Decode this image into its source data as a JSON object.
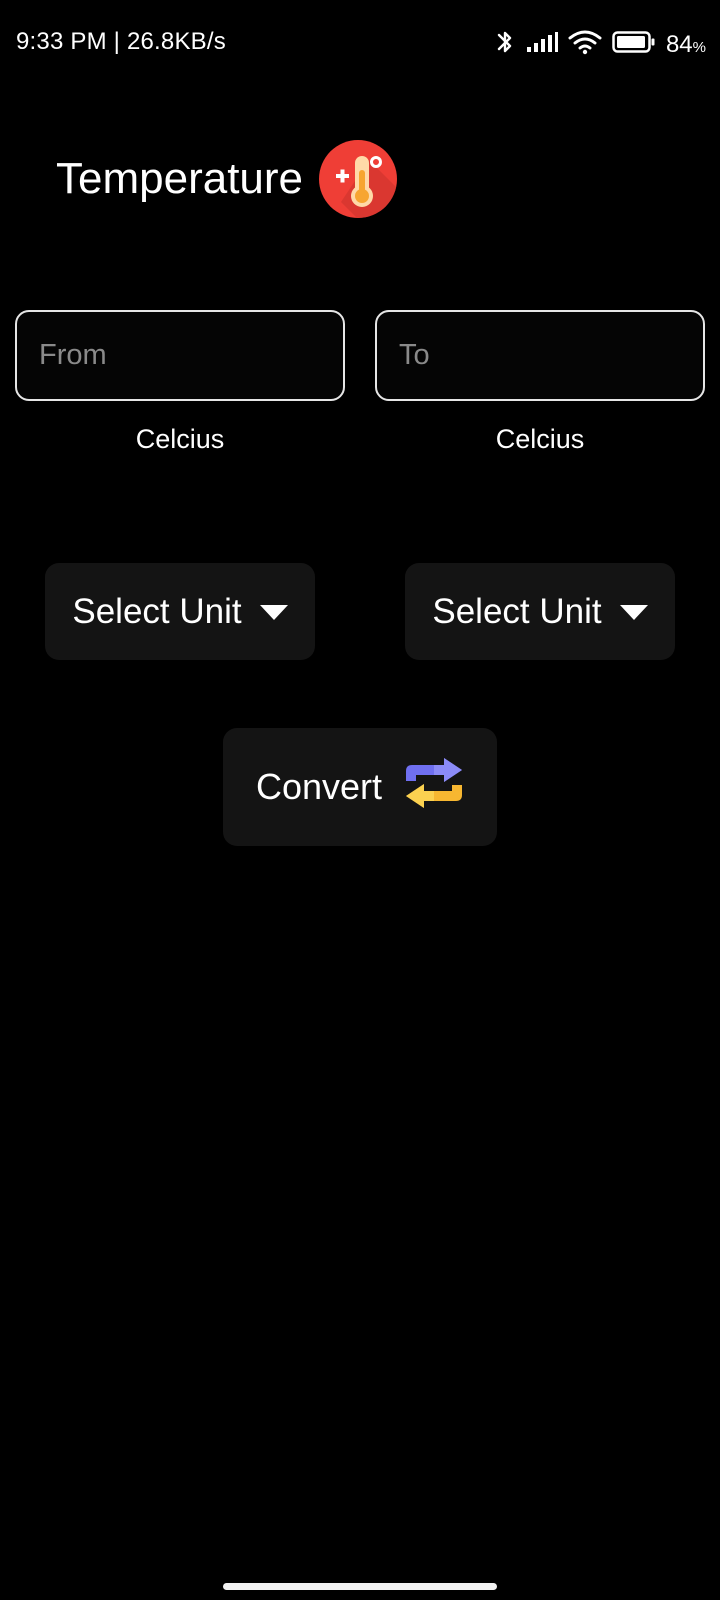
{
  "status_bar": {
    "time_and_speed": "9:33 PM | 26.8KB/s",
    "battery_level": "84",
    "battery_unit": "%"
  },
  "header": {
    "title": "Temperature",
    "icon": "thermometer-icon"
  },
  "inputs": {
    "from": {
      "placeholder": "From",
      "value": ""
    },
    "to": {
      "placeholder": "To",
      "value": ""
    }
  },
  "units": {
    "from_label": "Celcius",
    "to_label": "Celcius"
  },
  "dropdowns": {
    "left_label": "Select Unit",
    "right_label": "Select Unit"
  },
  "convert": {
    "label": "Convert",
    "icon": "swap-arrows-icon"
  },
  "colors": {
    "background": "#000000",
    "button_bg": "#141414",
    "thermo_red": "#ef3e36",
    "arrow_purple": "#6f6ff0",
    "arrow_yellow": "#f7b731"
  }
}
